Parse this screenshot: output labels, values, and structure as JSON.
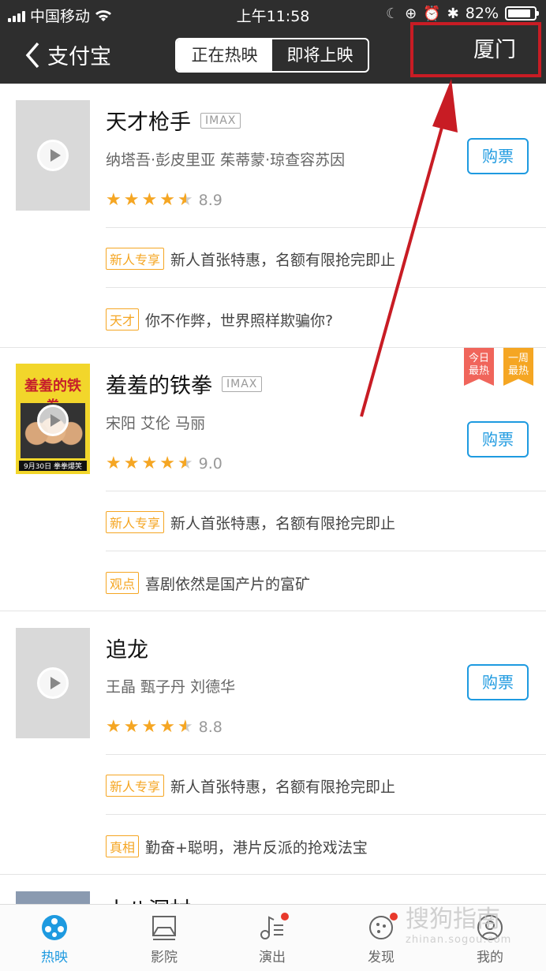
{
  "status": {
    "carrier": "中国移动",
    "time": "上午11:58",
    "battery": "82%"
  },
  "nav": {
    "back_label": "支付宝",
    "tabs": [
      "正在热映",
      "即将上映"
    ],
    "city": "厦门"
  },
  "movies": [
    {
      "title": "天才枪手",
      "format": "IMAX",
      "cast": "纳塔吾·彭皮里亚 茱蒂蒙·琼查容苏因",
      "score": "8.9",
      "buy": "购票",
      "promos": [
        {
          "tag": "新人专享",
          "text": "新人首张特惠，名额有限抢完即止"
        },
        {
          "tag": "天才",
          "text": "你不作弊，世界照样欺骗你?"
        }
      ]
    },
    {
      "title": "羞羞的铁拳",
      "format": "IMAX",
      "cast": "宋阳 艾伦 马丽",
      "score": "9.0",
      "buy": "购票",
      "poster_title": "羞羞的铁拳",
      "poster_date": "9月30日 拳拳爆笑",
      "badges": [
        "今日最热",
        "一周最热"
      ],
      "promos": [
        {
          "tag": "新人专享",
          "text": "新人首张特惠，名额有限抢完即止"
        },
        {
          "tag": "观点",
          "text": "喜剧依然是国产片的富矿"
        }
      ]
    },
    {
      "title": "追龙",
      "format": "",
      "cast": "王晶 甄子丹 刘德华",
      "score": "8.8",
      "buy": "购票",
      "promos": [
        {
          "tag": "新人专享",
          "text": "新人首张特惠，名额有限抢完即止"
        },
        {
          "tag": "真相",
          "text": "勤奋+聪明，港片反派的抢戏法宝"
        }
      ]
    },
    {
      "title": "小八洞村"
    }
  ],
  "tabbar": [
    "热映",
    "影院",
    "演出",
    "发现",
    "我的"
  ],
  "watermark": {
    "text": "搜狗指南",
    "url": "zhinan.sogou.com"
  },
  "colors": {
    "accent": "#1e9ae0",
    "star": "#f5a623",
    "annotation": "#c81c24"
  }
}
